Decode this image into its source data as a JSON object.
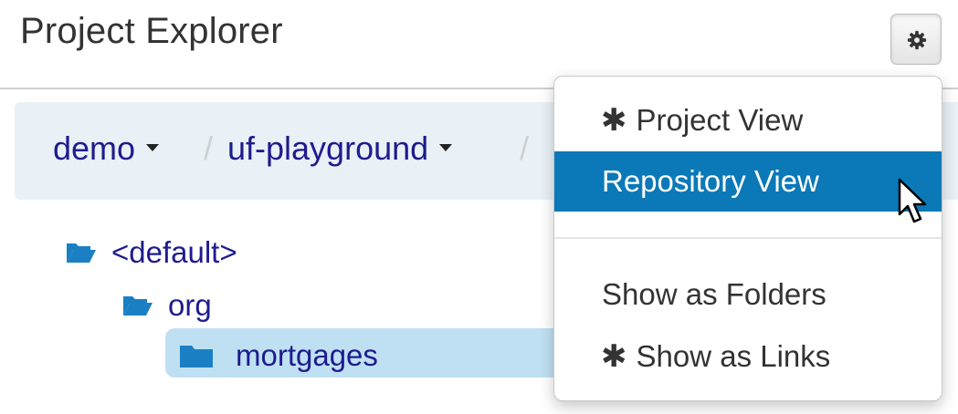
{
  "panel": {
    "title": "Project Explorer",
    "settings_icon": "gear-icon"
  },
  "breadcrumb": {
    "items": [
      {
        "label": "demo"
      },
      {
        "label": "uf-playground"
      }
    ],
    "separator": "/"
  },
  "tree": {
    "items": [
      {
        "label": "<default>",
        "icon": "folder-open-icon"
      },
      {
        "label": "org",
        "icon": "folder-open-icon"
      },
      {
        "label": "mortgages",
        "icon": "folder-closed-icon",
        "selected": true
      }
    ]
  },
  "view_menu": {
    "items": [
      {
        "label": "Project View",
        "icon": "asterisk-icon",
        "selected": true
      },
      {
        "label": "Repository View",
        "highlighted": true
      },
      {
        "label": "Show as Folders"
      },
      {
        "label": "Show as Links",
        "icon": "asterisk-icon",
        "selected": true
      }
    ]
  },
  "colors": {
    "link": "#1f1b8f",
    "highlight": "#0b79b8",
    "folder_icon": "#1b7fc4",
    "breadcrumb_bg": "#e9f1f7",
    "selected_row": "#bfe0f2"
  }
}
